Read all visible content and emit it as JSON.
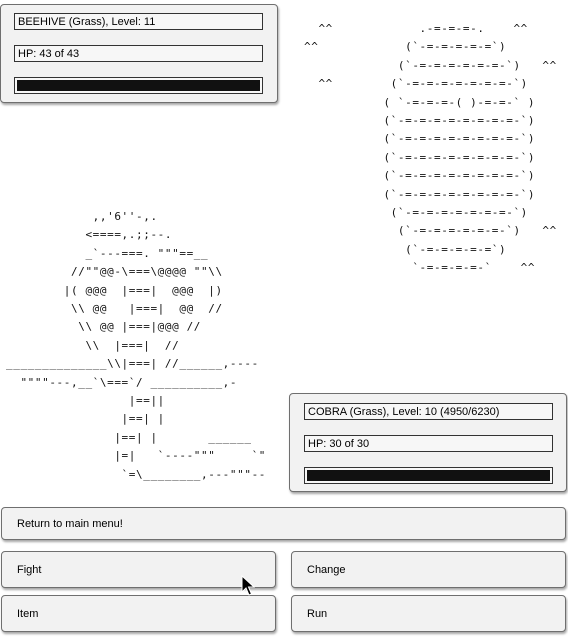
{
  "player": {
    "name_line": "BEEHIVE (Grass), Level: 11",
    "hp_line": "HP: 43 of 43",
    "hp_fraction": 1.0
  },
  "enemy": {
    "name_line": "COBRA (Grass), Level: 10 (4950/6230)",
    "hp_line": "HP: 30 of 30",
    "hp_fraction": 1.0
  },
  "beehive_art": "  ^^            .-=-=-=-.    ^^\n^^            (`-=-=-=-=-=`)\n             (`-=-=-=-=-=-=-`)   ^^\n  ^^        (`-=-=-=-=-=-=-=-`)\n           ( `-=-=-=-( )-=-=-` )\n           (`-=-=-=-=-=-=-=-=-`)\n           (`-=-=-=-=-=-=-=-=-`)\n           (`-=-=-=-=-=-=-=-=-`)\n           (`-=-=-=-=-=-=-=-=-`)\n           (`-=-=-=-=-=-=-=-=-`)\n            (`-=-=-=-=-=-=-=-`)\n             (`-=-=-=-=-=-=-`)   ^^\n              (`-=-=-=-=-=`)\n               `-=-=-=-=-`    ^^",
  "cobra_art": "            ,,'6''-,.\n           <====,.;;--.\n           _`---===. \"\"\"==__\n         //\"\"@@-\\===\\@@@@ \"\"\\\\\n        |( @@@  |===|  @@@  |)\n         \\\\ @@   |===|  @@  //\n          \\\\ @@ |===|@@@ //\n           \\\\  |===|  //\n______________\\\\|===| //______,----\n  \"\"\"\"---,__`\\===`/ __________,-\n                 |==||\n                |==| |\n               |==| |       ______\n               |=|   `----\"\"\"     `\"\n                `=\\________,---\"\"\"--",
  "buttons": {
    "main_menu": "Return to main menu!",
    "fight": "Fight",
    "change": "Change",
    "item": "Item",
    "run": "Run"
  }
}
